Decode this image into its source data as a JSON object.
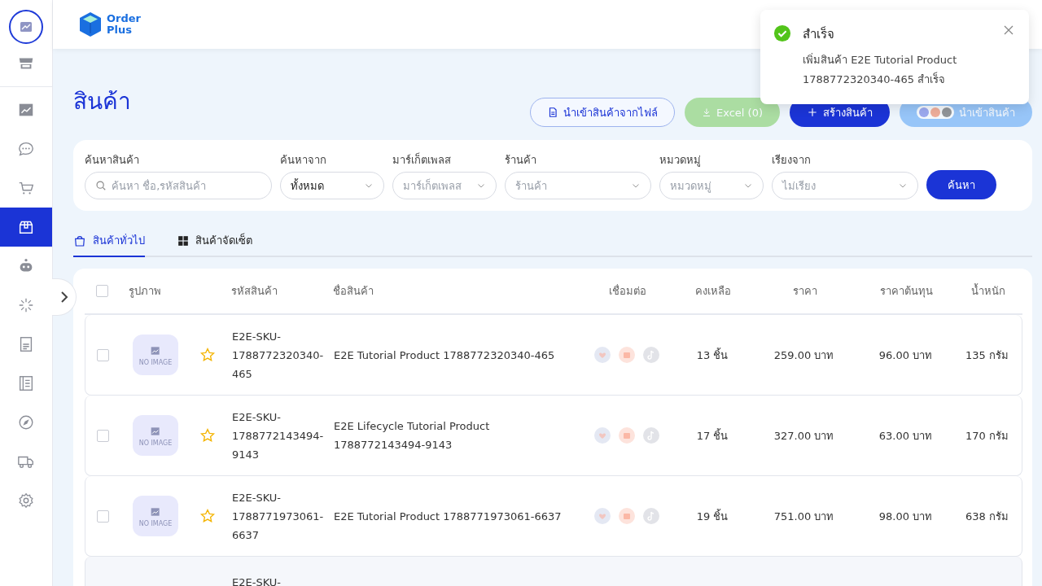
{
  "sidebar": {
    "items": [
      {
        "selected": false
      },
      {
        "selected": false
      },
      {
        "selected": false
      },
      {
        "selected": false
      },
      {
        "selected": true
      },
      {
        "selected": false
      },
      {
        "selected": false
      },
      {
        "selected": false
      },
      {
        "selected": false
      },
      {
        "selected": false
      },
      {
        "selected": false
      },
      {
        "selected": false
      }
    ]
  },
  "header": {
    "logo": [
      "Order",
      "Plus"
    ]
  },
  "toast": {
    "title": "สำเร็จ",
    "message": "เพิ่มสินค้า E2E Tutorial Product 1788772320340-465 สำเร็จ"
  },
  "page": {
    "title": "สินค้า"
  },
  "actions": [
    {
      "kind": "outline",
      "label": "นำเข้าสินค้าจากไฟล์",
      "disabled": false
    },
    {
      "kind": "excel",
      "label": "Excel (0)",
      "disabled": true
    },
    {
      "kind": "primary",
      "label": "สร้างสินค้า",
      "disabled": false
    },
    {
      "kind": "marketplace",
      "label": "นำเข้าสินค้า",
      "disabled": true
    }
  ],
  "filters": [
    {
      "kind": "search",
      "label": "ค้นหาสินค้า",
      "placeholder": "ค้นหา ชื่อ,รหัสสินค้า"
    },
    {
      "kind": "select",
      "label": "ค้นหาจาก",
      "value": "ทั้งหมด"
    },
    {
      "kind": "select",
      "label": "มาร์เก็ตเพลส",
      "placeholder": "มาร์เก็ตเพลส"
    },
    {
      "kind": "select",
      "label": "ร้านค้า",
      "placeholder": "ร้านค้า"
    },
    {
      "kind": "select",
      "label": "หมวดหมู่",
      "placeholder": "หมวดหมู่"
    },
    {
      "kind": "select",
      "label": "เรียงจาก",
      "placeholder": "ไม่เรียง"
    }
  ],
  "search_button": "ค้นหา",
  "tabs": [
    {
      "label": "สินค้าทั่วไป",
      "selected": true
    },
    {
      "label": "สินค้าจัดเซ็ต",
      "selected": false
    }
  ],
  "table": {
    "select_all": false,
    "columns": [
      "รูปภาพ",
      "รหัสสินค้า",
      "ชื่อสินค้า",
      "เชื่อมต่อ",
      "คงเหลือ",
      "ราคา",
      "ราคาต้นทุน",
      "น้ำหนัก"
    ],
    "rows": [
      {
        "checked": false,
        "image_label": "NO IMAGE",
        "sku": "E2E-SKU-1788772320340-465",
        "name": "E2E Tutorial Product 1788772320340-465",
        "stock": "13 ชิ้น",
        "price": "259.00 บาท",
        "cost": "96.00 บาท",
        "weight": "135 กรัม"
      },
      {
        "checked": false,
        "image_label": "NO IMAGE",
        "sku": "E2E-SKU-1788772143494-9143",
        "name": "E2E Lifecycle Tutorial Product 1788772143494-9143",
        "stock": "17 ชิ้น",
        "price": "327.00 บาท",
        "cost": "63.00 บาท",
        "weight": "170 กรัม"
      },
      {
        "checked": false,
        "image_label": "NO IMAGE",
        "sku": "E2E-SKU-1788771973061-6637",
        "name": "E2E Tutorial Product 1788771973061-6637",
        "stock": "19 ชิ้น",
        "price": "751.00 บาท",
        "cost": "98.00 บาท",
        "weight": "638 กรัม"
      },
      {
        "sku": "E2E-SKU-"
      }
    ]
  }
}
